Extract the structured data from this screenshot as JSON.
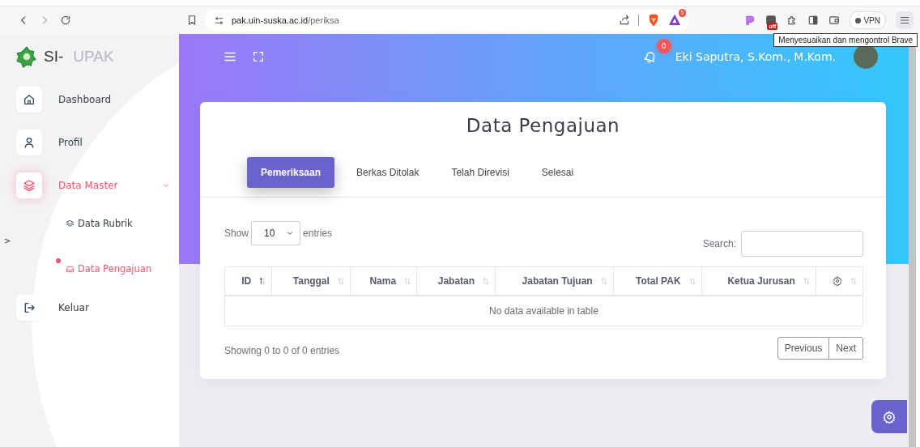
{
  "browser": {
    "url_host": "pak.uin-suska.ac.id",
    "url_path": "/periksa",
    "brave_badge": "5",
    "extension_badge": "off",
    "vpn_label": "VPN",
    "tooltip": "Menyesuaikan dan mengontrol Brave"
  },
  "sidebar": {
    "logo_prefix": "SI-",
    "logo_name": "UPAK",
    "collapse_toggle": ">",
    "items": [
      {
        "label": "Dashboard",
        "selected": false
      },
      {
        "label": "Profil",
        "selected": false
      },
      {
        "label": "Data Master",
        "selected": true,
        "expanded": true,
        "children": [
          {
            "label": "Data Rubrik",
            "selected": false
          },
          {
            "label": "Data Pengajuan",
            "selected": true
          }
        ]
      },
      {
        "label": "Keluar",
        "selected": false
      }
    ]
  },
  "topbar": {
    "notification_count": "0",
    "user_name": "Eki Saputra, S.Kom., M.Kom."
  },
  "card": {
    "title": "Data Pengajuan",
    "tabs": [
      {
        "label": "Pemeriksaan",
        "selected": true
      },
      {
        "label": "Berkas Ditolak",
        "selected": false
      },
      {
        "label": "Telah Direvisi",
        "selected": false
      },
      {
        "label": "Selesai",
        "selected": false
      }
    ],
    "length": {
      "before": "Show",
      "value": "10",
      "after": "entries"
    },
    "search": {
      "label": "Search:"
    },
    "table": {
      "columns": [
        {
          "label": "ID",
          "sorted": true
        },
        {
          "label": "Tanggal",
          "sorted": false
        },
        {
          "label": "Nama",
          "sorted": false
        },
        {
          "label": "Jabatan",
          "sorted": false
        },
        {
          "label": "Jabatan Tujuan",
          "sorted": false
        },
        {
          "label": "Total PAK",
          "sorted": false
        },
        {
          "label": "Ketua Jurusan",
          "sorted": false
        },
        {
          "kind": "icon",
          "sorted": false
        }
      ],
      "empty_message": "No data available in table"
    },
    "info": "Showing 0 to 0 of 0 entries",
    "pagination": [
      "Previous",
      "Next"
    ]
  }
}
